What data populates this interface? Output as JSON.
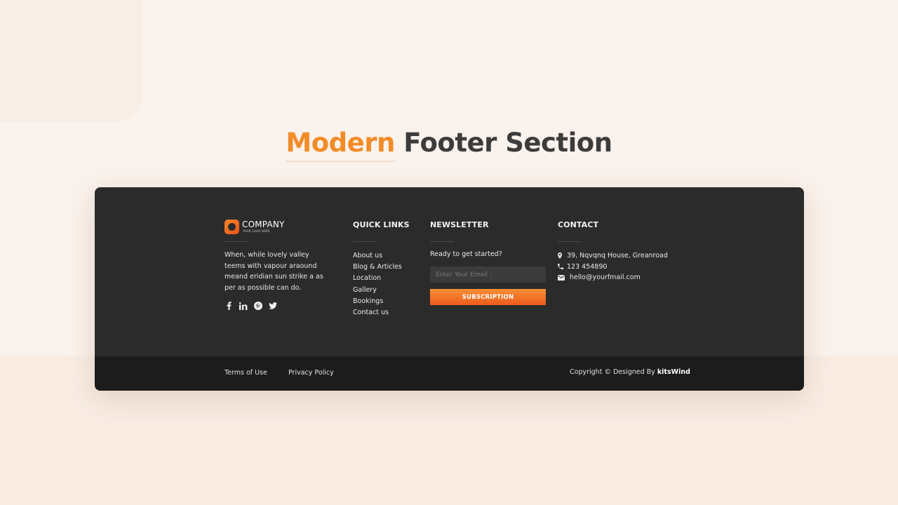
{
  "page": {
    "heading_accent": "Modern",
    "heading_rest": "Footer Section",
    "accent_color": "#f28c28"
  },
  "footer": {
    "brand": {
      "name": "COMPANY",
      "tagline": "YOUR LOGO HERE",
      "description": "When, while lovely valley teems with vapour araound meand eridian sun strike a as per as possible can do.",
      "socials": [
        {
          "icon": "facebook-icon",
          "glyph": "f"
        },
        {
          "icon": "linkedin-icon",
          "glyph": "in"
        },
        {
          "icon": "pinterest-icon",
          "glyph": "℗"
        },
        {
          "icon": "twitter-icon",
          "glyph": "🐦"
        }
      ]
    },
    "quick_links": {
      "title": "QUICK LINKS",
      "items": [
        "About us",
        "Blog & Articles",
        "Location",
        "Gallery",
        "Bookings",
        "Contact us"
      ]
    },
    "newsletter": {
      "title": "NEWSLETTER",
      "prompt": "Ready to get started?",
      "email_placeholder": "Enter Your Email :",
      "email_value": "",
      "button_label": "SUBSCRIPTION",
      "button_color": "#f26b22"
    },
    "contact": {
      "title": "CONTACT",
      "address": "39, Nqvqnq House, Greanroad",
      "phone": "123 454890",
      "email": "hello@yourfmail.com"
    },
    "bottom": {
      "terms_label": "Terms of Use",
      "privacy_label": "Privacy Policy",
      "copyright_prefix": "Copyright © Designed By",
      "copyright_brand": "kitsWind"
    }
  }
}
